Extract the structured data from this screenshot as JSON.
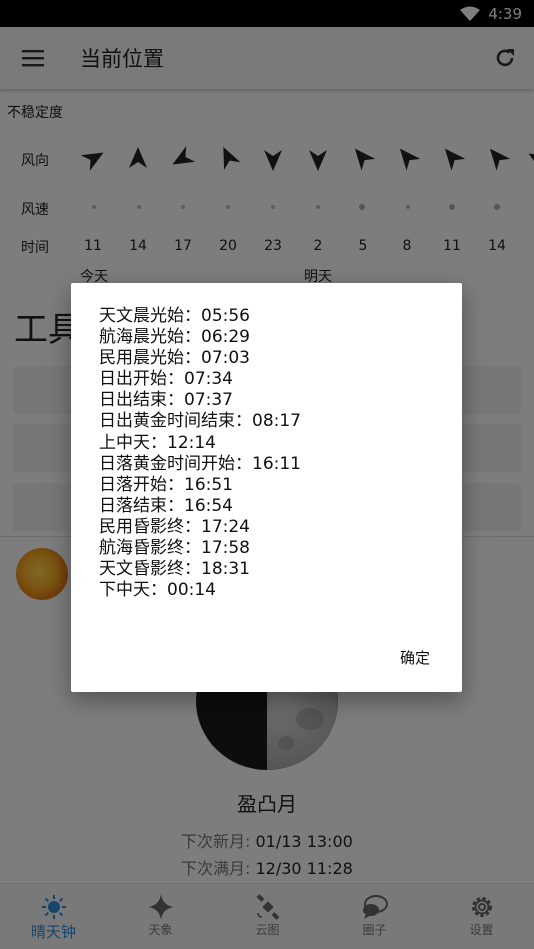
{
  "status_bar": {
    "time": "4:39"
  },
  "app_bar": {
    "title": "当前位置"
  },
  "wind": {
    "unstable_label": "不稳定度",
    "direction_label": "风向",
    "speed_label": "风速",
    "time_label": "时间",
    "times": [
      "11",
      "14",
      "17",
      "20",
      "23",
      "2",
      "5",
      "8",
      "11",
      "14"
    ],
    "day_labels": [
      "今天",
      "明天"
    ]
  },
  "tools": {
    "title": "工具"
  },
  "moon": {
    "phase_name": "盈凸月",
    "next_new_label": "下次新月:",
    "next_new_value": "01/13 13:00",
    "next_full_label": "下次满月:",
    "next_full_value": "12/30 11:28"
  },
  "dialog": {
    "lines": [
      "天文晨光始：05:56",
      "航海晨光始：06:29",
      "民用晨光始：07:03",
      "日出开始：07:34",
      "日出结束：07:37",
      "日出黄金时间结束：08:17",
      "上中天：12:14",
      "日落黄金时间开始：16:11",
      "日落开始：16:51",
      "日落结束：16:54",
      "民用昏影终：17:24",
      "航海昏影终：17:58",
      "天文昏影终：18:31",
      "下中天：00:14"
    ],
    "ok_label": "确定"
  },
  "bottom_nav": [
    {
      "label": "晴天钟",
      "icon": "sun-icon",
      "active": true
    },
    {
      "label": "天象",
      "icon": "star-icon",
      "active": false
    },
    {
      "label": "云图",
      "icon": "satellite-icon",
      "active": false
    },
    {
      "label": "圈子",
      "icon": "chat-icon",
      "active": false
    },
    {
      "label": "设置",
      "icon": "gear-icon",
      "active": false
    }
  ],
  "colors": {
    "accent": "#2e8bd8",
    "scrim": "#00000080"
  }
}
